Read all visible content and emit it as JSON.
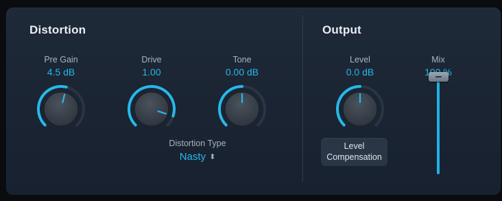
{
  "distortion": {
    "title": "Distortion",
    "pre_gain": {
      "label": "Pre Gain",
      "value": "4.5 dB",
      "level": 0.55
    },
    "drive": {
      "label": "Drive",
      "value": "1.00",
      "level": 0.9
    },
    "tone": {
      "label": "Tone",
      "value": "0.00 dB",
      "level": 0.5
    },
    "distortion_type": {
      "label": "Distortion Type",
      "value": "Nasty"
    }
  },
  "output": {
    "title": "Output",
    "level": {
      "label": "Level",
      "value": "0.0 dB",
      "level": 0.5
    },
    "level_compensation": {
      "line1": "Level",
      "line2": "Compensation"
    },
    "mix": {
      "label": "Mix",
      "value": "100 %",
      "level": 1.0
    }
  },
  "colors": {
    "accent": "#27b8ea",
    "panel": "#1c2736",
    "ring_track": "#2a3442",
    "knob": "#3d4550"
  }
}
